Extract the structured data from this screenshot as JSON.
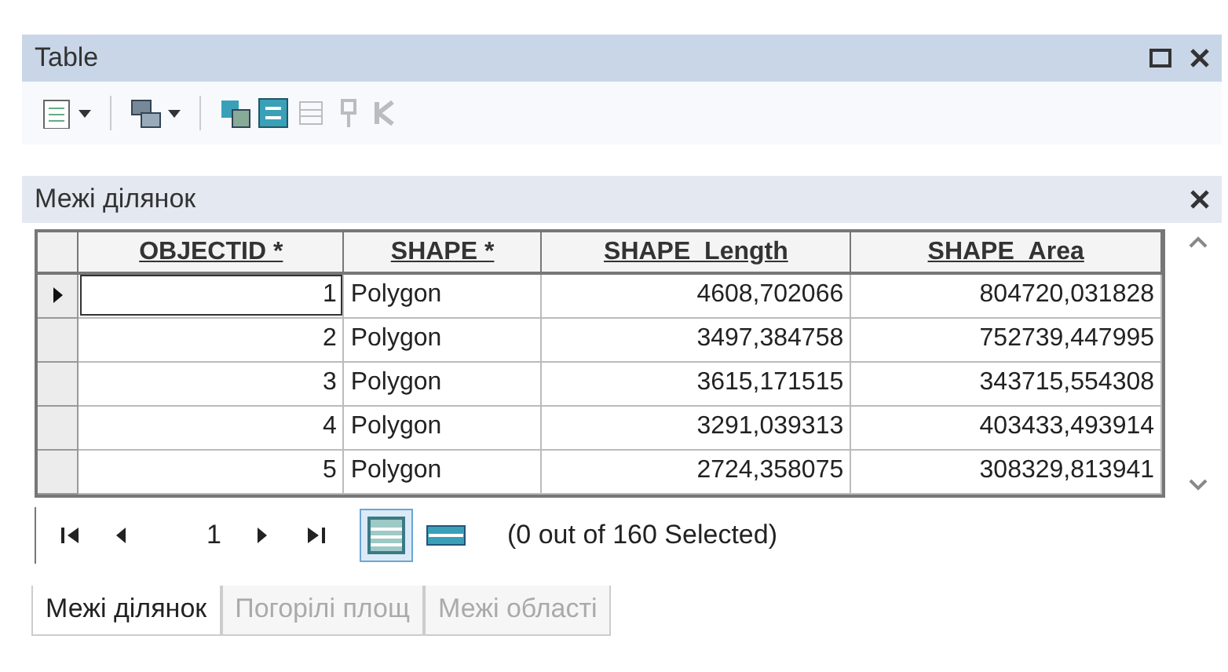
{
  "window": {
    "title": "Table"
  },
  "toolbar": [
    {
      "kind": "list",
      "dropdown": true,
      "disabled": false
    },
    {
      "kind": "stack",
      "dropdown": true,
      "disabled": false
    },
    {
      "kind": "copy",
      "dropdown": false,
      "disabled": false
    },
    {
      "kind": "swap",
      "dropdown": false,
      "disabled": false
    },
    {
      "kind": "rows",
      "dropdown": false,
      "disabled": true
    },
    {
      "kind": "pin",
      "dropdown": false,
      "disabled": true
    },
    {
      "kind": "cross",
      "dropdown": false,
      "disabled": true
    }
  ],
  "layer": {
    "title": "Межі ділянок"
  },
  "table": {
    "columns": [
      "OBJECTID *",
      "SHAPE *",
      "SHAPE_Length",
      "SHAPE_Area"
    ],
    "rows": [
      {
        "current": true,
        "cells": [
          "1",
          "Polygon",
          "4608,702066",
          "804720,031828"
        ]
      },
      {
        "current": false,
        "cells": [
          "2",
          "Polygon",
          "3497,384758",
          "752739,447995"
        ]
      },
      {
        "current": false,
        "cells": [
          "3",
          "Polygon",
          "3615,171515",
          "343715,554308"
        ]
      },
      {
        "current": false,
        "cells": [
          "4",
          "Polygon",
          "3291,039313",
          "403433,493914"
        ]
      },
      {
        "current": false,
        "cells": [
          "5",
          "Polygon",
          "2724,358075",
          "308329,813941"
        ]
      }
    ]
  },
  "navigation": {
    "record": "1",
    "views": [
      {
        "selected": true
      },
      {
        "selected": false
      }
    ],
    "status": "(0 out of 160 Selected)"
  },
  "tabs": [
    {
      "label": "Межі ділянок",
      "selected": true
    },
    {
      "label": "Погорілі площ",
      "selected": false
    },
    {
      "label": "Межі області",
      "selected": false
    }
  ]
}
